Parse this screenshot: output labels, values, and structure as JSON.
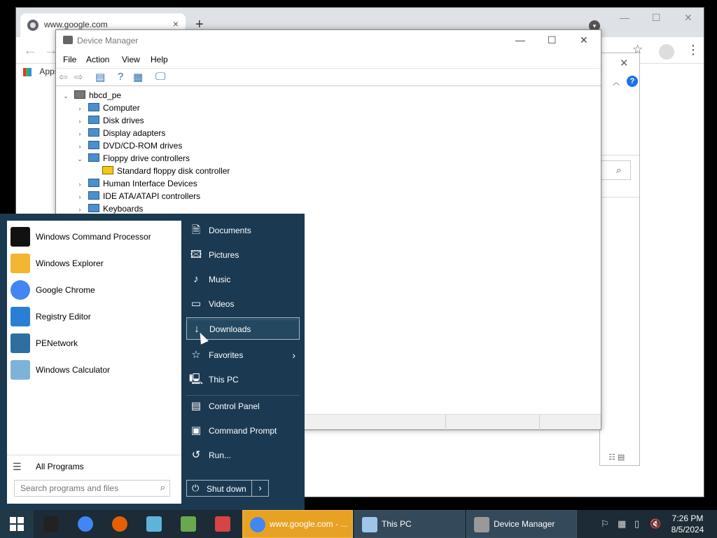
{
  "chrome": {
    "tab_title": "www.google.com",
    "tab_close": "×",
    "new_tab": "+",
    "bookmarks_label": "Apps"
  },
  "device_manager": {
    "title": "Device Manager",
    "menu": [
      "File",
      "Action",
      "View",
      "Help"
    ],
    "tree": [
      {
        "label": "hbcd_pe",
        "level": 0,
        "expanded": true,
        "icon": "computer-icon"
      },
      {
        "label": "Computer",
        "level": 1,
        "expanded": false,
        "icon": "monitor-icon"
      },
      {
        "label": "Disk drives",
        "level": 1,
        "expanded": false,
        "icon": "disk-icon"
      },
      {
        "label": "Display adapters",
        "level": 1,
        "expanded": false,
        "icon": "display-adapter-icon"
      },
      {
        "label": "DVD/CD-ROM drives",
        "level": 1,
        "expanded": false,
        "icon": "dvd-icon"
      },
      {
        "label": "Floppy drive controllers",
        "level": 1,
        "expanded": true,
        "icon": "controller-icon"
      },
      {
        "label": "Standard floppy disk controller",
        "level": 2,
        "expanded": null,
        "icon": "warning-controller-icon"
      },
      {
        "label": "Human Interface Devices",
        "level": 1,
        "expanded": false,
        "icon": "hid-icon"
      },
      {
        "label": "IDE ATA/ATAPI controllers",
        "level": 1,
        "expanded": false,
        "icon": "ide-icon"
      },
      {
        "label": "Keyboards",
        "level": 1,
        "expanded": false,
        "icon": "keyboard-icon"
      }
    ]
  },
  "start_menu": {
    "programs": [
      {
        "label": "Windows Command Processor",
        "icon": "cmd-icon",
        "color": "#111111"
      },
      {
        "label": "Windows Explorer",
        "icon": "folder-icon",
        "color": "#f2b632"
      },
      {
        "label": "Google Chrome",
        "icon": "chrome-icon",
        "color": "#4285f4"
      },
      {
        "label": "Registry Editor",
        "icon": "registry-icon",
        "color": "#2a7fd4"
      },
      {
        "label": "PENetwork",
        "icon": "network-icon",
        "color": "#2f6f9f"
      },
      {
        "label": "Windows Calculator",
        "icon": "calculator-icon",
        "color": "#7fb2d9"
      }
    ],
    "all_programs": "All Programs",
    "search_placeholder": "Search programs and files",
    "places": [
      {
        "label": "Documents",
        "icon": "documents-icon",
        "glyph": "🗎"
      },
      {
        "label": "Pictures",
        "icon": "pictures-icon",
        "glyph": "🖾"
      },
      {
        "label": "Music",
        "icon": "music-icon",
        "glyph": "♪"
      },
      {
        "label": "Videos",
        "icon": "videos-icon",
        "glyph": "▭"
      },
      {
        "label": "Downloads",
        "icon": "download-icon",
        "glyph": "↓",
        "selected": true
      },
      {
        "label": "Favorites",
        "icon": "star-icon",
        "glyph": "☆",
        "submenu": true
      },
      {
        "label": "This PC",
        "icon": "pc-icon",
        "glyph": "🖳"
      },
      {
        "label": "Control Panel",
        "icon": "control-panel-icon",
        "glyph": "▤"
      },
      {
        "label": "Command Prompt",
        "icon": "command-prompt-icon",
        "glyph": "▣"
      },
      {
        "label": "Run...",
        "icon": "run-icon",
        "glyph": "↺"
      }
    ],
    "shutdown": "Shut down"
  },
  "taskbar": {
    "pinned": [
      {
        "name": "cmd",
        "icon": "cmd-icon",
        "color": "#222222"
      },
      {
        "name": "chrome",
        "icon": "chrome-icon",
        "color": "#4285f4"
      },
      {
        "name": "firefox",
        "icon": "firefox-icon",
        "color": "#e66000"
      },
      {
        "name": "notepad",
        "icon": "notepad-icon",
        "color": "#5fb3d9"
      },
      {
        "name": "task-manager",
        "icon": "taskmgr-icon",
        "color": "#6aa84f"
      },
      {
        "name": "paint",
        "icon": "paint-icon",
        "color": "#d64545"
      }
    ],
    "windows": [
      {
        "label": "www.google.com - ...",
        "icon": "chrome-icon",
        "color": "#4285f4",
        "active": true
      },
      {
        "label": "This PC",
        "icon": "pc-icon",
        "color": "#9fc5e8",
        "active": false
      },
      {
        "label": "Device Manager",
        "icon": "device-manager-icon",
        "color": "#999999",
        "active": false
      }
    ],
    "time": "7:26 PM",
    "date": "8/5/2024"
  },
  "colors": {
    "start_menu_bg": "#1b3a52",
    "taskbar_bg": "#1c2b36",
    "active_window_btn": "#e8a223"
  }
}
